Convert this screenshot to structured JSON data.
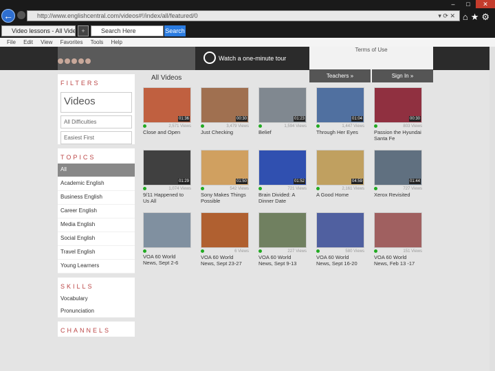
{
  "browser": {
    "url": "http://www.englishcentral.com/videos#!/index/all/featured/0",
    "tab_label": "Video lessons - All Videos",
    "search_placeholder": "Search Here",
    "search_button": "Search",
    "menus": [
      "File",
      "Edit",
      "View",
      "Favorites",
      "Tools",
      "Help"
    ]
  },
  "banner": {
    "watch_label": "Watch a one-minute tour",
    "terms": "Terms of Use",
    "teachers_button": "Teachers »",
    "sign_in_button": "Sign In »"
  },
  "sidebar": {
    "filters_heading": "FILTERS",
    "videos_select": "Videos",
    "difficulty_select": "All Difficulties",
    "sort_select": "Easiest First",
    "topics_heading": "TOPICS",
    "topics": [
      "All",
      "Academic English",
      "Business English",
      "Career English",
      "Media English",
      "Social English",
      "Travel English",
      "Young Learners"
    ],
    "skills_heading": "SKILLS",
    "skills": [
      "Vocabulary",
      "Pronunciation"
    ],
    "channels_heading": "CHANNELS"
  },
  "content": {
    "heading": "All Videos",
    "videos": [
      {
        "title": "Close and Open",
        "views": "2,571 Views",
        "duration": "01:36"
      },
      {
        "title": "Just Checking",
        "views": "3,479 Views",
        "duration": "00:30"
      },
      {
        "title": "Belief",
        "views": "1,594 Views",
        "duration": "01:23"
      },
      {
        "title": "Through Her Eyes",
        "views": "1,447 Views",
        "duration": "01:04"
      },
      {
        "title": "Passion the Hyundai Santa Fe",
        "views": "803 Views",
        "duration": "00:30"
      },
      {
        "title": "9/11 Happened to Us All",
        "views": "1,074 Views",
        "duration": "01:29"
      },
      {
        "title": "Sony Makes Things Possible",
        "views": "542 Views",
        "duration": "01:50"
      },
      {
        "title": "Brain Divided: A Dinner Date",
        "views": "721 Views",
        "duration": "01:52"
      },
      {
        "title": "A Good Home",
        "views": "2,161 Views",
        "duration": "04:59"
      },
      {
        "title": "Xerox Revisited",
        "views": "727 Views",
        "duration": "01:44"
      },
      {
        "title": "VOA 60 World News, Sept 2-6",
        "views": "",
        "duration": ""
      },
      {
        "title": "VOA 60 World News, Sept 23-27",
        "views": "6 Views",
        "duration": ""
      },
      {
        "title": "VOA 60 World News, Sept 9-13",
        "views": "227 Views",
        "duration": ""
      },
      {
        "title": "VOA 60 World News, Sept 16-20",
        "views": "580 Views",
        "duration": ""
      },
      {
        "title": "VOA 60 World News, Feb 13 -17",
        "views": "151 Views",
        "duration": ""
      }
    ]
  }
}
